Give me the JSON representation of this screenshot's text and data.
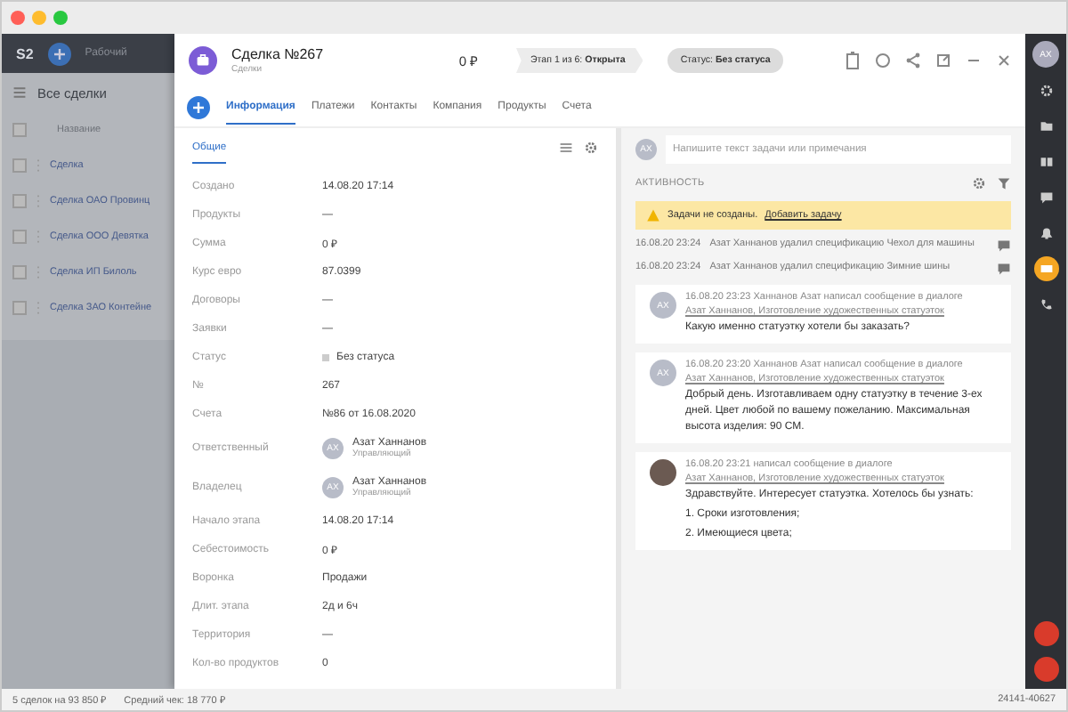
{
  "background_app": {
    "logo": "S2",
    "workspace": "Рабочий",
    "list_title": "Все сделки",
    "column": "Название",
    "header_checked": false,
    "rows": [
      {
        "name": "Сделка",
        "checked": false
      },
      {
        "name": "Сделка ОАО Провинц",
        "checked": false
      },
      {
        "name": "Сделка ООО Девятка",
        "checked": false
      },
      {
        "name": "Сделка ИП Билоль",
        "checked": false
      },
      {
        "name": "Сделка ЗАО Контейне",
        "checked": false
      }
    ]
  },
  "deal": {
    "title": "Сделка №267",
    "subtitle": "Сделки",
    "amount": "0 ₽",
    "stage": "Этап 1 из 6: **Открыта**",
    "status": "Статус: **Без статуса**",
    "tabs": [
      {
        "label": "Информация",
        "selected": true
      },
      {
        "label": "Платежи",
        "selected": false
      },
      {
        "label": "Контакты",
        "selected": false
      },
      {
        "label": "Компания",
        "selected": false
      },
      {
        "label": "Продукты",
        "selected": false
      },
      {
        "label": "Счета",
        "selected": false
      }
    ],
    "subtabs": [
      {
        "label": "Общие",
        "selected": true
      }
    ],
    "fields": [
      {
        "kind": "text",
        "label": "Создано",
        "value": "14.08.20 17:14"
      },
      {
        "kind": "text",
        "label": "Продукты",
        "value": "—"
      },
      {
        "kind": "text",
        "label": "Сумма",
        "value": "0 ₽"
      },
      {
        "kind": "text",
        "label": "Курс евро",
        "value": "87.0399"
      },
      {
        "kind": "text",
        "label": "Договоры",
        "value": "—"
      },
      {
        "kind": "text",
        "label": "Заявки",
        "value": "—"
      },
      {
        "kind": "status",
        "label": "Статус",
        "value": "Без статуса"
      },
      {
        "kind": "text",
        "label": "№",
        "value": "267"
      },
      {
        "kind": "text",
        "label": "Счета",
        "value": "№86 от 16.08.2020"
      },
      {
        "kind": "person",
        "label": "Ответственный",
        "value": "Азат Ханнанов",
        "role": "Управляющий",
        "initials": "AX"
      },
      {
        "kind": "person",
        "label": "Владелец",
        "value": "Азат Ханнанов",
        "role": "Управляющий",
        "initials": "AX"
      },
      {
        "kind": "text",
        "label": "Начало этапа",
        "value": "14.08.20 17:14"
      },
      {
        "kind": "text",
        "label": "Себестоимость",
        "value": "0 ₽"
      },
      {
        "kind": "text",
        "label": "Воронка",
        "value": "Продажи"
      },
      {
        "kind": "text",
        "label": "Длит. этапа",
        "value": "2д и 6ч"
      },
      {
        "kind": "text",
        "label": "Территория",
        "value": "—"
      },
      {
        "kind": "text",
        "label": "Кол-во продуктов",
        "value": "0"
      }
    ],
    "comment": {
      "initials": "AX",
      "placeholder": "Напишите текст задачи или примечания"
    },
    "activity": {
      "title": "АКТИВНОСТЬ",
      "notice": {
        "text": "Задачи не созданы.",
        "link": "Добавить задачу"
      },
      "log": [
        {
          "time": "16.08.20 23:24",
          "text": "Азат Ханнанов удалил спецификацию Чехол для машины"
        },
        {
          "time": "16.08.20 23:24",
          "text": "Азат Ханнанов удалил спецификацию Зимние шины"
        }
      ],
      "messages": [
        {
          "kind": "initials",
          "initials": "AX",
          "header": "16.08.20 23:23 Ханнанов Азат написал сообщение в диалоге",
          "link": "Азат Ханнанов, Изготовление художественных статуэток",
          "lines": [
            "Какую именно статуэтку хотели бы заказать?"
          ]
        },
        {
          "kind": "initials",
          "initials": "AX",
          "header": "16.08.20 23:20 Ханнанов Азат написал сообщение в диалоге",
          "link": "Азат Ханнанов, Изготовление художественных статуэток",
          "lines": [
            "Добрый день. Изготавливаем одну статуэтку в течение 3-ех дней. Цвет любой по вашему пожеланию. Максимальная высота изделия: 90 СМ."
          ]
        },
        {
          "kind": "photo",
          "header": "16.08.20 23:21 написал сообщение в диалоге",
          "link": "Азат Ханнанов, Изготовление художественных статуэток",
          "lines": [
            "Здравствуйте. Интересует статуэтка. Хотелось бы узнать:",
            "1. Сроки изготовления;",
            "2. Имеющиеся цвета;"
          ]
        }
      ]
    }
  },
  "right_sidebar": {
    "initials": "AX",
    "items": [
      {
        "kind": "gear",
        "selected": false
      },
      {
        "kind": "folder",
        "selected": false
      },
      {
        "kind": "book",
        "selected": false
      },
      {
        "kind": "chat",
        "selected": false
      },
      {
        "kind": "bell",
        "selected": false
      },
      {
        "kind": "mail",
        "selected": true
      },
      {
        "kind": "phone",
        "selected": false
      }
    ]
  },
  "status_bar": {
    "count": "5 сделок на 93 850 ₽",
    "average": "Средний чек: 18 770 ₽",
    "range": "24141-40627"
  }
}
